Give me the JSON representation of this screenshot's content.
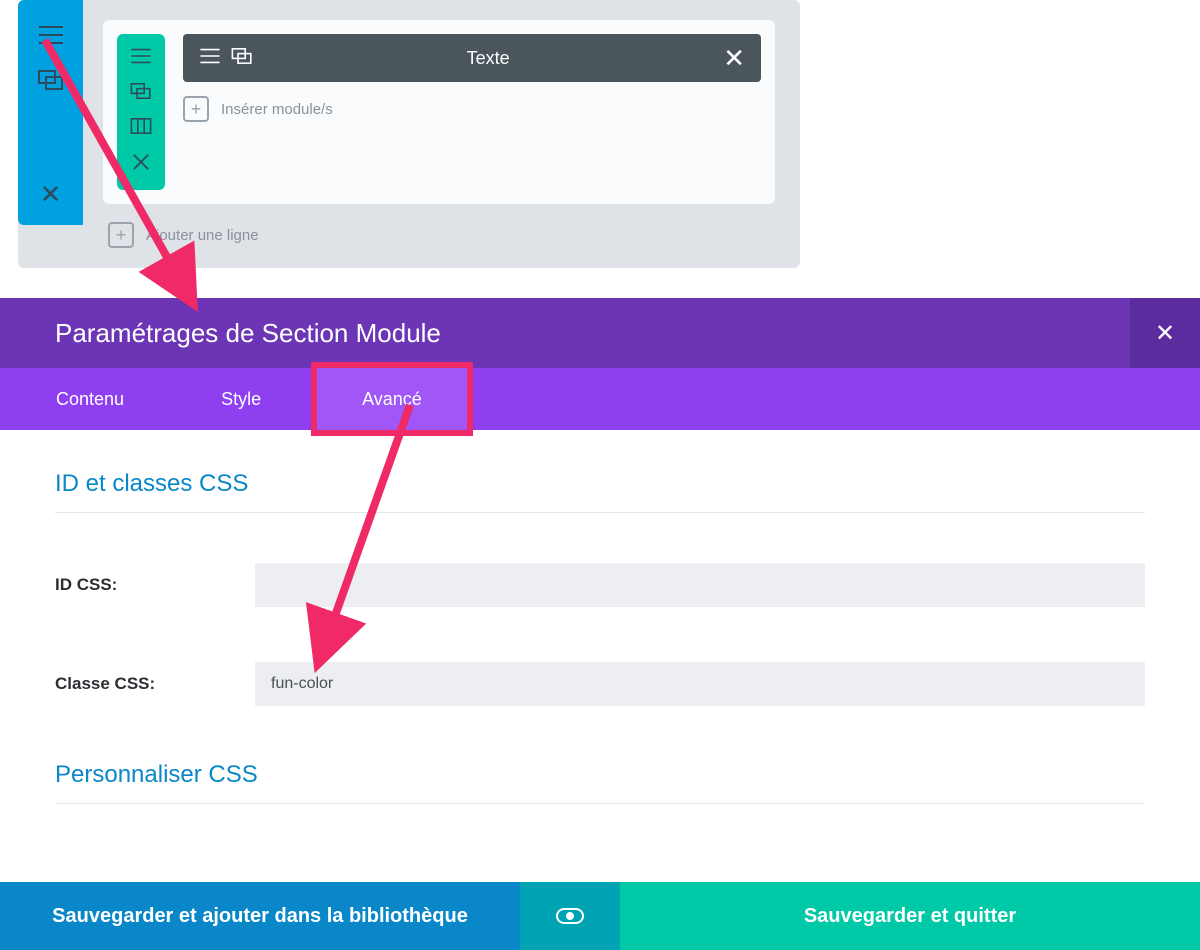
{
  "builder": {
    "module_title": "Texte",
    "insert_module_label": "Insérer module/s",
    "add_line_label": "Ajouter une ligne"
  },
  "modal": {
    "title": "Paramétrages de Section Module",
    "tabs": {
      "content": "Contenu",
      "style": "Style",
      "advanced": "Avancé"
    },
    "sections": {
      "id_classes": "ID et classes CSS",
      "custom_css": "Personnaliser CSS"
    },
    "fields": {
      "id_css_label": "ID CSS:",
      "id_css_value": "",
      "class_css_label": "Classe CSS:",
      "class_css_value": "fun-color"
    }
  },
  "footer": {
    "save_library": "Sauvegarder et ajouter dans la bibliothèque",
    "save_quit": "Sauvegarder et quitter"
  },
  "colors": {
    "purple_dark": "#6b35b5",
    "purple": "#8e3ff0",
    "purple_light": "#a156f7",
    "blue": "#00a1e0",
    "teal": "#00c9a7",
    "cyan": "#00a3b3",
    "link_blue": "#0a87c9",
    "annotation_pink": "#ef2a66"
  }
}
